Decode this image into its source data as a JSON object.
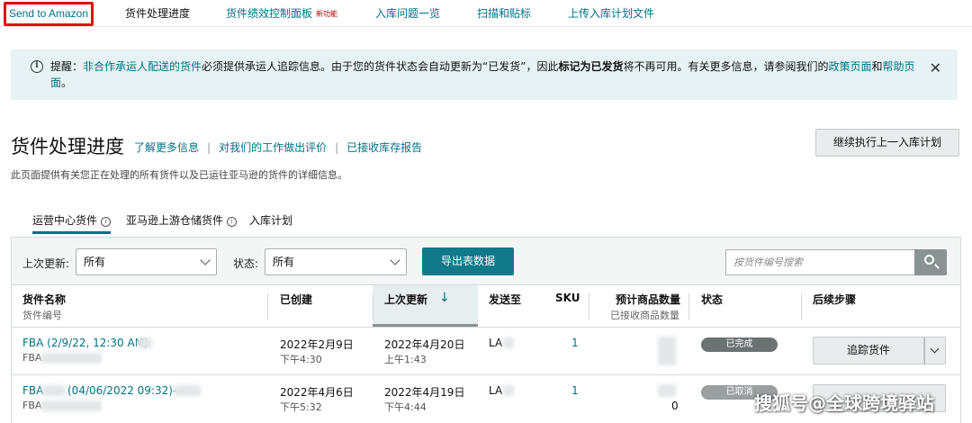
{
  "nav": {
    "send_to_amazon": "Send to Amazon",
    "items": [
      "货件处理进度",
      "货件绩效控制面板",
      "入库问题一览",
      "扫描和贴标",
      "上传入库计划文件"
    ],
    "new_badge": "新功能"
  },
  "alert": {
    "prefix": "提醒：",
    "link1": "非合作承运人配送的货件",
    "text1": "必须提供承运人追踪信息。由于您的货件状态会自动更新为“已发货”，因此",
    "bold": "标记为已发货",
    "text2": "将不再可用。有关更多信息，请参阅我们的",
    "link2": "政策页面",
    "and": "和",
    "link3": "帮助页面",
    "end": "。"
  },
  "header": {
    "title": "货件处理进度",
    "links": [
      "了解更多信息",
      "对我们的工作做出评价",
      "已接收库存报告"
    ],
    "continue_button": "继续执行上一入库计划",
    "description": "此页面提供有关您正在处理的所有货件以及已运往亚马逊的货件的详细信息。"
  },
  "tabs": [
    {
      "label": "运营中心货件",
      "help": true
    },
    {
      "label": "亚马逊上游仓储货件",
      "help": true
    },
    {
      "label": "入库计划",
      "help": false
    }
  ],
  "filters": {
    "last_updated_label": "上次更新:",
    "last_updated_value": "所有",
    "status_label": "状态:",
    "status_value": "所有",
    "export_button": "导出表数据",
    "search_placeholder": "按货件编号搜索"
  },
  "table": {
    "columns": [
      {
        "title": "货件名称",
        "sub": "货件编号"
      },
      {
        "title": "已创建",
        "sub": ""
      },
      {
        "title": "上次更新",
        "sub": ""
      },
      {
        "title": "发送至",
        "sub": ""
      },
      {
        "title": "SKU",
        "sub": ""
      },
      {
        "title": "预计商品数量",
        "sub": "已接收商品数量"
      },
      {
        "title": "状态",
        "sub": ""
      },
      {
        "title": "后续步骤",
        "sub": ""
      }
    ],
    "rows": [
      {
        "name": "FBA (2/9/22, 12:30 AM)",
        "id": "FBA",
        "created_date": "2022年2月9日",
        "created_time": "下午4:30",
        "updated_date": "2022年4月20日",
        "updated_time": "上午1:43",
        "ship_to": "LA",
        "sku": "1",
        "received": "",
        "status": "已完成",
        "action": "追踪货件"
      },
      {
        "name_prefix": "FBA",
        "name": "(04/06/2022 09:32)-",
        "id": "FBA",
        "created_date": "2022年4月6日",
        "created_time": "下午5:32",
        "updated_date": "2022年4月19日",
        "updated_time": "下午4:44",
        "ship_to": "LA",
        "sku": "1",
        "received": "0",
        "status": "已取消",
        "action": ""
      }
    ]
  },
  "watermark": "搜狐号@全球跨境驿站",
  "colors": {
    "link": "#007185",
    "export": "#107a8b",
    "alert_bg": "#e6f2f3",
    "highlight": "#e01010"
  }
}
